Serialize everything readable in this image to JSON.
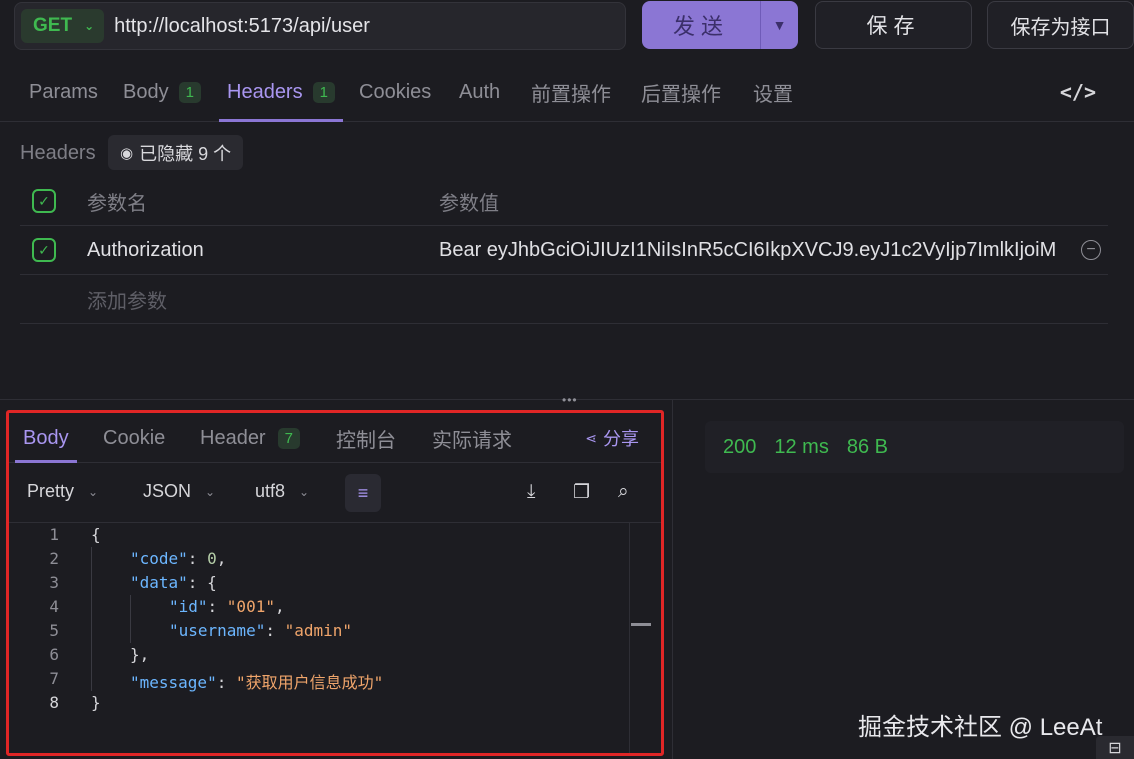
{
  "request": {
    "method": "GET",
    "url": "http://localhost:5173/api/user",
    "send_label": "发送",
    "save_label": "保存",
    "save_as_label": "保存为接口"
  },
  "req_tabs": [
    {
      "label": "Params"
    },
    {
      "label": "Body",
      "badge": "1"
    },
    {
      "label": "Headers",
      "badge": "1"
    },
    {
      "label": "Cookies"
    },
    {
      "label": "Auth"
    },
    {
      "label": "前置操作"
    },
    {
      "label": "后置操作"
    },
    {
      "label": "设置"
    }
  ],
  "active_req_tab": "Headers",
  "headers": {
    "section_label": "Headers",
    "hidden_label": "已隐藏 9 个",
    "col_name": "参数名",
    "col_value": "参数值",
    "rows": [
      {
        "name": "Authorization",
        "value": "Bear eyJhbGciOiJIUzI1NiIsInR5cCI6IkpXVCJ9.eyJ1c2VyIjp7ImlkIjoiM",
        "enabled": true
      }
    ],
    "add_placeholder": "添加参数"
  },
  "response": {
    "tabs": [
      {
        "label": "Body"
      },
      {
        "label": "Cookie"
      },
      {
        "label": "Header",
        "badge": "7"
      },
      {
        "label": "控制台"
      },
      {
        "label": "实际请求"
      }
    ],
    "active_tab": "Body",
    "share_label": "分享",
    "format": "Pretty",
    "type": "JSON",
    "encoding": "utf8",
    "code_lines": [
      "{",
      "\"code\": 0,",
      "\"data\": {",
      "\"id\": \"001\",",
      "\"username\": \"admin\"",
      "},",
      "\"message\": \"获取用户信息成功\"",
      "}"
    ]
  },
  "status": {
    "code": "200",
    "time": "12 ms",
    "size": "86 B"
  },
  "watermark": "掘金技术社区 @ LeeAt",
  "colors": {
    "accent": "#8b76d4",
    "success": "#3fb950",
    "highlight_border": "#e02626",
    "background": "#1c1c21"
  }
}
